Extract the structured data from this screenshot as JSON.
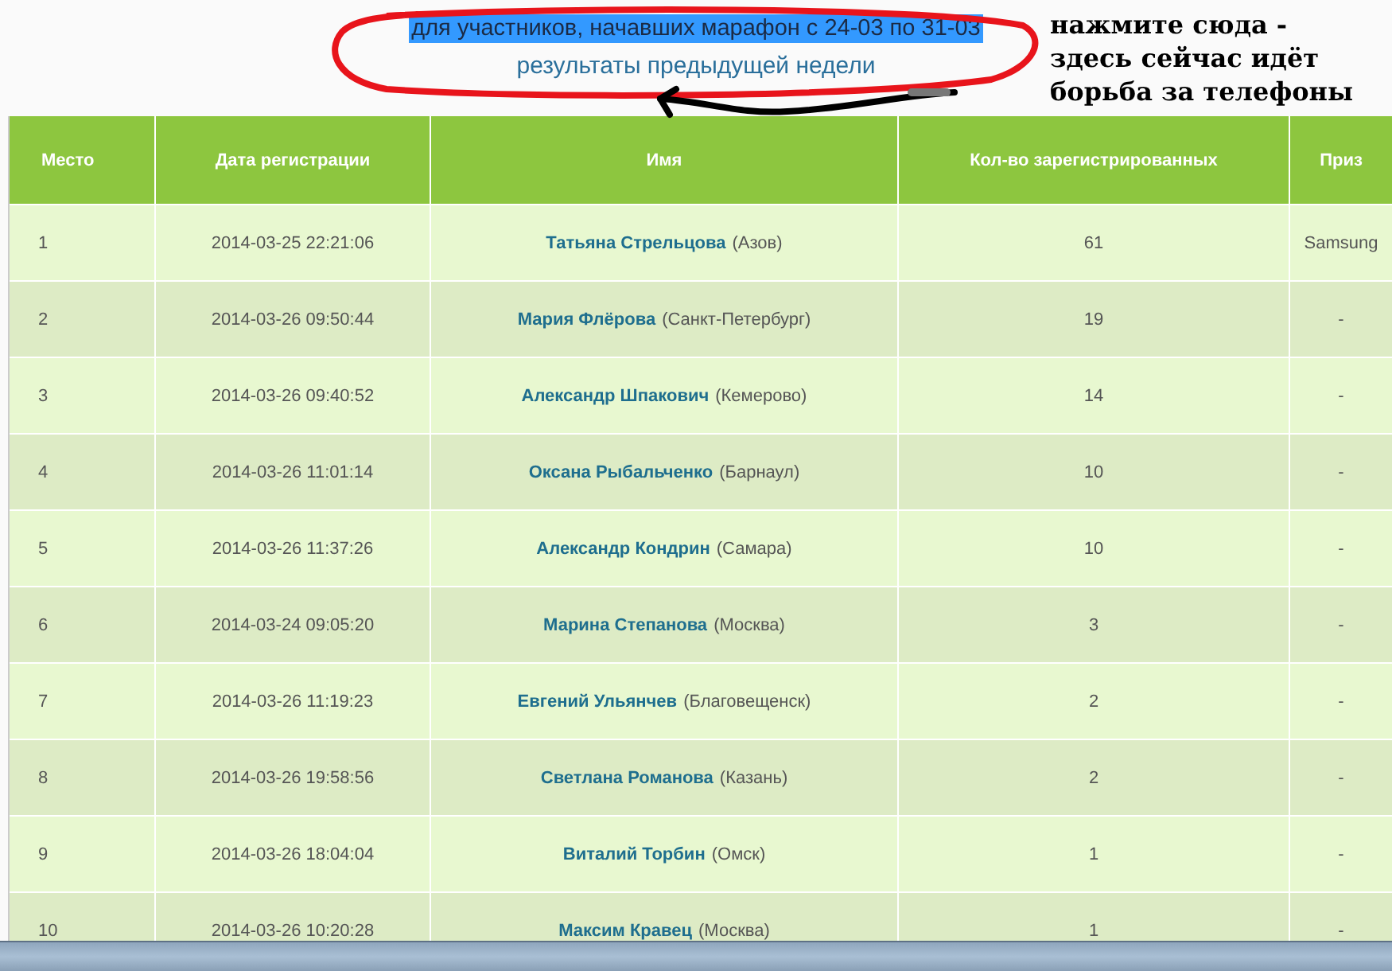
{
  "heading": {
    "text": "для участников, начавших марафон с 24-03 по 31-03",
    "selected": true
  },
  "link": "результаты предыдущей недели",
  "annotation": {
    "note_lines": [
      "нажмите сюда -",
      "здесь сейчас идёт",
      "борьба за телефоны"
    ]
  },
  "table": {
    "columns": [
      "Место",
      "Дата регистрации",
      "Имя",
      "Кол-во зарегистрированных",
      "Приз"
    ],
    "rows": [
      {
        "place": "1",
        "date": "2014-03-25 22:21:06",
        "name": "Татьяна Стрельцова",
        "city": "(Азов)",
        "count": "61",
        "prize": "Samsung"
      },
      {
        "place": "2",
        "date": "2014-03-26 09:50:44",
        "name": "Мария Флёрова",
        "city": "(Санкт-Петербург)",
        "count": "19",
        "prize": "-"
      },
      {
        "place": "3",
        "date": "2014-03-26 09:40:52",
        "name": "Александр Шпакович",
        "city": "(Кемерово)",
        "count": "14",
        "prize": "-"
      },
      {
        "place": "4",
        "date": "2014-03-26 11:01:14",
        "name": "Оксана Рыбальченко",
        "city": "(Барнаул)",
        "count": "10",
        "prize": "-"
      },
      {
        "place": "5",
        "date": "2014-03-26 11:37:26",
        "name": "Александр Кондрин",
        "city": "(Самара)",
        "count": "10",
        "prize": "-"
      },
      {
        "place": "6",
        "date": "2014-03-24 09:05:20",
        "name": "Марина Степанова",
        "city": "(Москва)",
        "count": "3",
        "prize": "-"
      },
      {
        "place": "7",
        "date": "2014-03-26 11:19:23",
        "name": "Евгений Ульянчев",
        "city": "(Благовещенск)",
        "count": "2",
        "prize": "-"
      },
      {
        "place": "8",
        "date": "2014-03-26 19:58:56",
        "name": "Светлана Романова",
        "city": "(Казань)",
        "count": "2",
        "prize": "-"
      },
      {
        "place": "9",
        "date": "2014-03-26 18:04:04",
        "name": "Виталий Торбин",
        "city": "(Омск)",
        "count": "1",
        "prize": "-"
      },
      {
        "place": "10",
        "date": "2014-03-26 10:20:28",
        "name": "Максим Кравец",
        "city": "(Москва)",
        "count": "1",
        "prize": "-"
      }
    ]
  }
}
